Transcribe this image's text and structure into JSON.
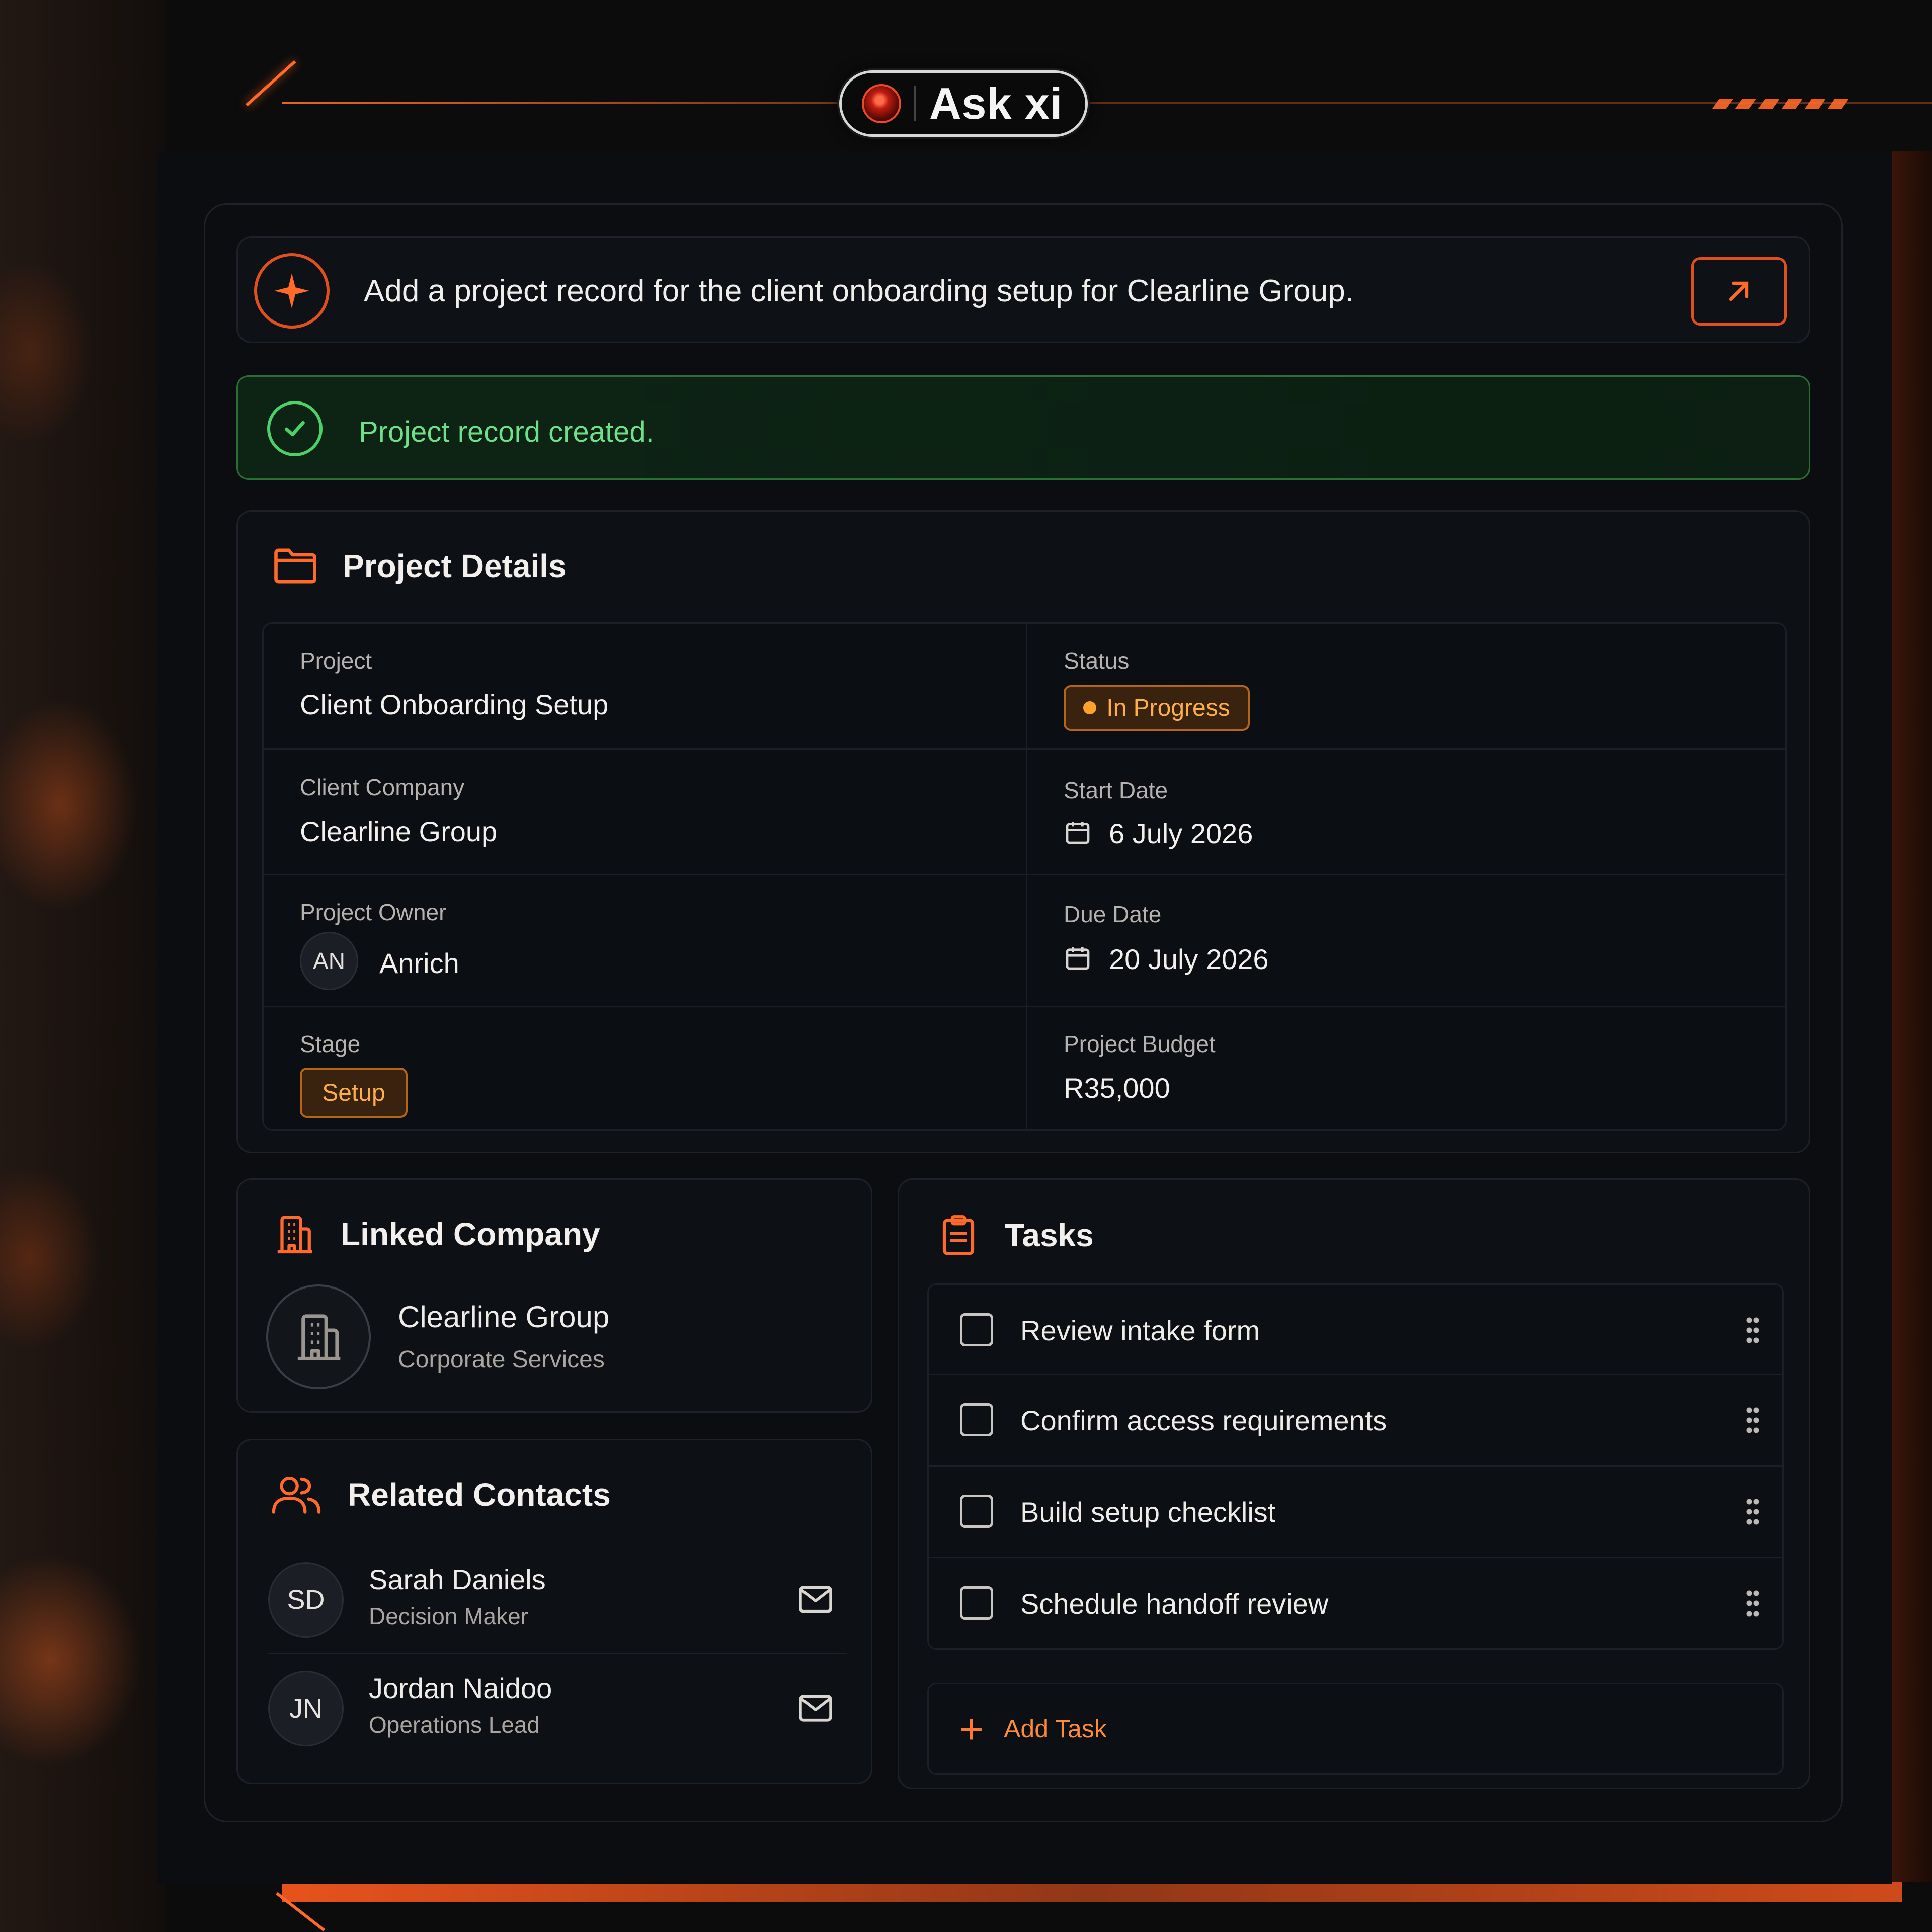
{
  "badge": {
    "title": "Ask xi"
  },
  "prompt": {
    "text": "Add a project record for the client onboarding setup for Clearline Group.",
    "open_icon": "arrow-up-right-icon",
    "spark_icon": "sparkle-icon"
  },
  "success": {
    "text": "Project record created."
  },
  "details": {
    "title": "Project Details",
    "fields": {
      "project_label": "Project",
      "project_value": "Client Onboarding Setup",
      "status_label": "Status",
      "status_value": "In Progress",
      "client_label": "Client Company",
      "client_value": "Clearline Group",
      "start_label": "Start Date",
      "start_value": "6 July 2026",
      "owner_label": "Project Owner",
      "owner_initials": "AN",
      "owner_value": "Anrich",
      "due_label": "Due Date",
      "due_value": "20 July 2026",
      "stage_label": "Stage",
      "stage_value": "Setup",
      "budget_label": "Project Budget",
      "budget_value": "R35,000"
    }
  },
  "linked": {
    "title": "Linked Company",
    "name": "Clearline Group",
    "industry": "Corporate Services"
  },
  "contacts": {
    "title": "Related Contacts",
    "items": [
      {
        "initials": "SD",
        "name": "Sarah Daniels",
        "role": "Decision Maker"
      },
      {
        "initials": "JN",
        "name": "Jordan Naidoo",
        "role": "Operations Lead"
      }
    ]
  },
  "tasks": {
    "title": "Tasks",
    "items": [
      {
        "label": "Review intake form"
      },
      {
        "label": "Confirm access requirements"
      },
      {
        "label": "Build setup checklist"
      },
      {
        "label": "Schedule handoff review"
      }
    ],
    "add_label": "Add Task"
  },
  "colors": {
    "accent": "#ff6a28",
    "success": "#4bd06a",
    "amber": "#ffa12b",
    "panel": "#0b0d11"
  }
}
